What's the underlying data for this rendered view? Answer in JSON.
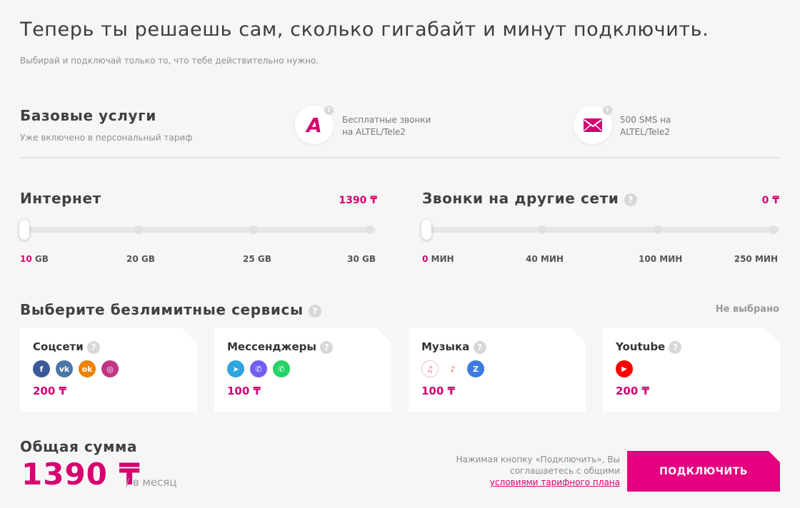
{
  "header": {
    "title": "Теперь ты решаешь сам, сколько гигабайт и минут подключить.",
    "subtitle": "Выбирай и подключай только то, что тебе действительно нужно."
  },
  "base_services": {
    "title": "Базовые услуги",
    "subtitle": "Уже включено в персональный тариф",
    "features": [
      {
        "icon": "altel-logo-icon",
        "line1": "Бесплатные звонки",
        "line2": "на ALTEL/Tele2",
        "logo_letter": "A"
      },
      {
        "icon": "envelope-icon",
        "line1": "500 SMS на",
        "line2": "ALTEL/Tele2"
      }
    ]
  },
  "internet": {
    "title": "Интернет",
    "price": "1390 ₸",
    "selected_index": 0,
    "stops": [
      {
        "value": "10",
        "unit": "GB"
      },
      {
        "value": "20",
        "unit": "GB"
      },
      {
        "value": "25",
        "unit": "GB"
      },
      {
        "value": "30",
        "unit": "GB"
      }
    ]
  },
  "calls": {
    "title": "Звонки на другие сети",
    "price": "0 ₸",
    "selected_index": 0,
    "stops": [
      {
        "value": "0",
        "unit": "МИН"
      },
      {
        "value": "40",
        "unit": "МИН"
      },
      {
        "value": "100",
        "unit": "МИН"
      },
      {
        "value": "250",
        "unit": "МИН"
      }
    ]
  },
  "unlimited": {
    "title": "Выберите безлимитные сервисы",
    "status": "Не выбрано",
    "cards": [
      {
        "title": "Соцсети",
        "price": "200 ₸",
        "icons": [
          {
            "name": "facebook-icon",
            "glyph": "f",
            "color": "#3b5998"
          },
          {
            "name": "vk-icon",
            "glyph": "vk",
            "color": "#4a76a8"
          },
          {
            "name": "odnoklassniki-icon",
            "glyph": "ok",
            "color": "#ee8208"
          },
          {
            "name": "instagram-icon",
            "glyph": "◎",
            "color": "#c13584"
          }
        ]
      },
      {
        "title": "Мессенджеры",
        "price": "100 ₸",
        "icons": [
          {
            "name": "telegram-icon",
            "glyph": "➤",
            "color": "#2ca5e0"
          },
          {
            "name": "viber-icon",
            "glyph": "✆",
            "color": "#7360f2"
          },
          {
            "name": "whatsapp-icon",
            "glyph": "✆",
            "color": "#25d366"
          }
        ]
      },
      {
        "title": "Музыка",
        "price": "100 ₸",
        "icons": [
          {
            "name": "apple-music-icon",
            "glyph": "♫",
            "color": "#fc5c7d"
          },
          {
            "name": "yandex-music-icon",
            "glyph": "♪",
            "color": "#ffcc00"
          },
          {
            "name": "zvooq-icon",
            "glyph": "Z",
            "color": "#3d7be0"
          }
        ]
      },
      {
        "title": "Youtube",
        "price": "200 ₸",
        "icons": [
          {
            "name": "youtube-icon",
            "glyph": "▶",
            "color": "#ff0000"
          }
        ]
      }
    ]
  },
  "total": {
    "title": "Общая сумма",
    "amount": "1390 ₸",
    "period": "/ в месяц"
  },
  "agreement": {
    "text": "Нажимая кнопку «Подключить», Вы соглашаетесь с общими",
    "link": "условиями тарифного плана"
  },
  "connect_button": {
    "label": "ПОДКЛЮЧИТЬ"
  },
  "colors": {
    "accent": "#d6006f",
    "button": "#e4007f"
  }
}
